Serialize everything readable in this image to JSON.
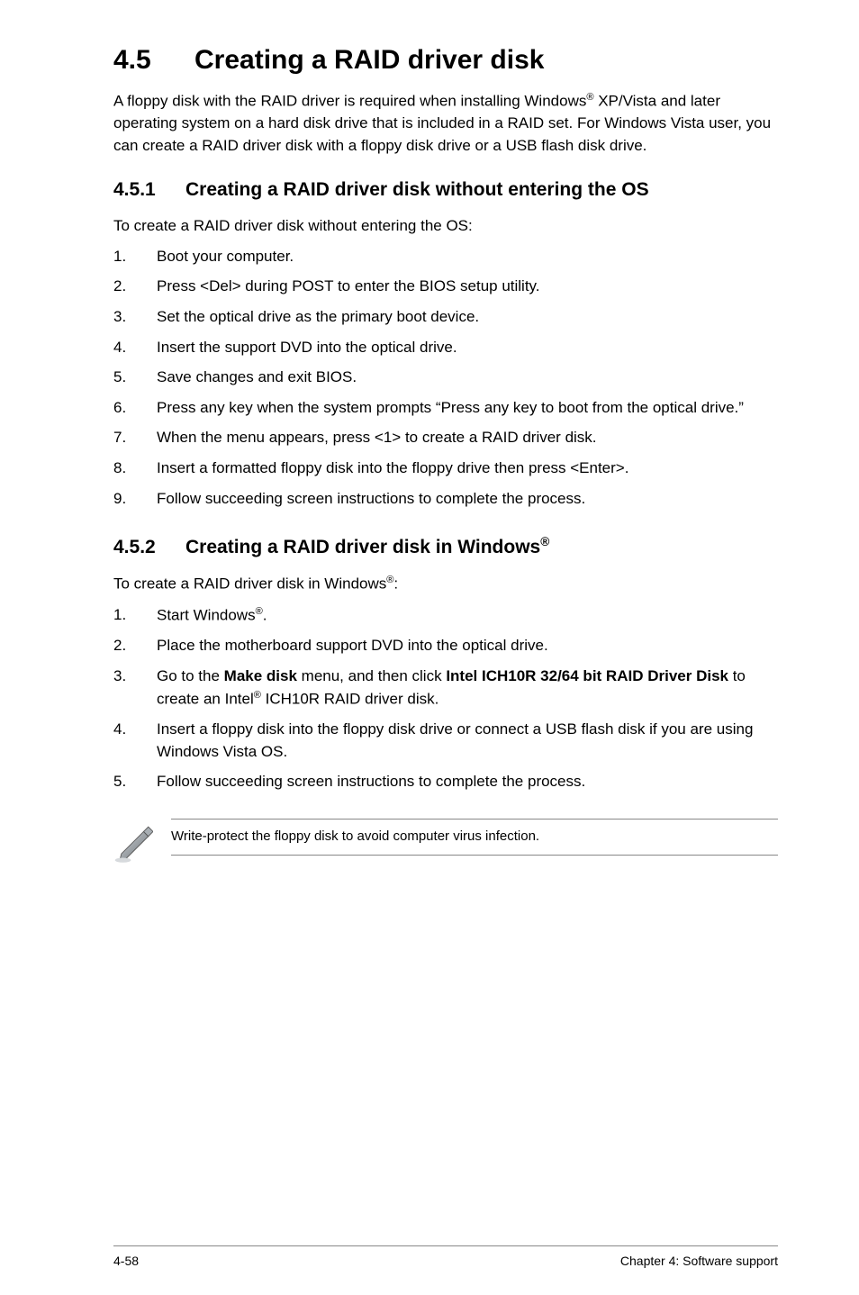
{
  "heading": {
    "number": "4.5",
    "title": "Creating a RAID driver disk"
  },
  "intro": {
    "p1": "A floppy disk with the RAID driver is required when installing Windows",
    "sup1": "®",
    "p2": " XP/Vista and later operating system on a hard disk drive that is included in a RAID set. For Windows Vista user, you can create a RAID driver disk with a floppy disk drive or a USB flash disk drive."
  },
  "section1": {
    "number": "4.5.1",
    "title": "Creating a RAID driver disk without entering the OS",
    "lead": "To create a RAID driver disk without entering the OS:",
    "items": [
      {
        "idx": "1.",
        "text": "Boot your computer."
      },
      {
        "idx": "2.",
        "text": "Press <Del> during POST to enter the BIOS setup utility."
      },
      {
        "idx": "3.",
        "text": "Set the optical drive as the primary boot device."
      },
      {
        "idx": "4.",
        "text": "Insert the support DVD into the optical drive."
      },
      {
        "idx": "5.",
        "text": "Save changes and exit BIOS."
      },
      {
        "idx": "6.",
        "text": "Press any key when the system prompts “Press any key to boot from the optical drive.”"
      },
      {
        "idx": "7.",
        "text": "When the menu appears, press <1> to create a RAID driver disk."
      },
      {
        "idx": "8.",
        "text": "Insert a formatted floppy disk into the floppy drive then press <Enter>."
      },
      {
        "idx": "9.",
        "text": "Follow succeeding screen instructions to complete the process."
      }
    ]
  },
  "section2": {
    "number": "4.5.2",
    "title_pre": "Creating a RAID driver disk in Windows",
    "title_sup": "®",
    "lead_pre": "To create a RAID driver disk in Windows",
    "lead_sup": "®",
    "lead_post": ":",
    "items_i1_idx": "1.",
    "items_i1_pre": "Start Windows",
    "items_i1_sup": "®",
    "items_i1_post": ".",
    "items_i2_idx": "2.",
    "items_i2_text": "Place the motherboard support DVD into the optical drive.",
    "items_i3_idx": "3.",
    "items_i3_a": "Go to the ",
    "items_i3_b": "Make disk",
    "items_i3_c": " menu, and then click ",
    "items_i3_d": "Intel ICH10R 32/64 bit RAID Driver Disk",
    "items_i3_e": " to create an Intel",
    "items_i3_sup": "®",
    "items_i3_f": " ICH10R RAID driver disk.",
    "items_i4_idx": "4.",
    "items_i4_text": "Insert a floppy disk into the floppy disk drive or connect a USB flash disk if you are using Windows Vista OS.",
    "items_i5_idx": "5.",
    "items_i5_text": "Follow succeeding screen instructions to complete the process."
  },
  "note": {
    "text": "Write-protect the floppy disk to avoid computer virus infection."
  },
  "footer": {
    "left": "4-58",
    "right": "Chapter 4: Software support"
  }
}
